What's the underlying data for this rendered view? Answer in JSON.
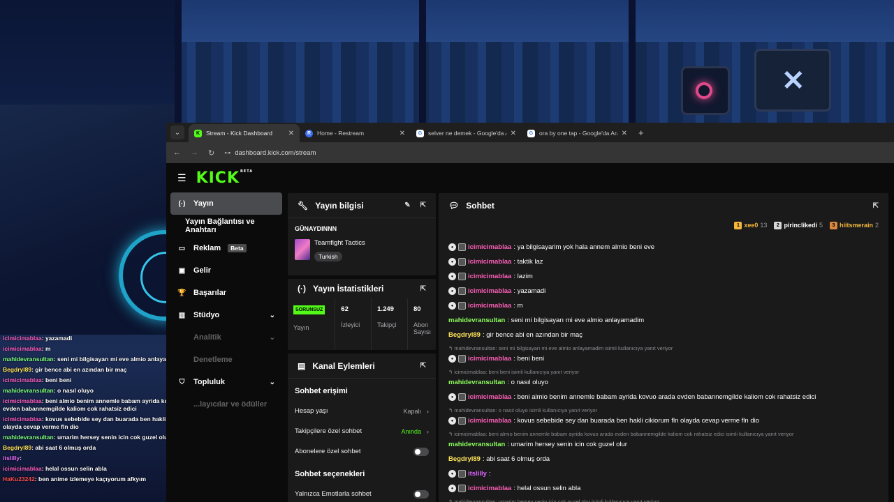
{
  "browser": {
    "tabs": [
      {
        "title": "Stream - Kick Dashboard",
        "favicon": "K",
        "color": "#53fc18",
        "active": true
      },
      {
        "title": "Home - Restream",
        "favicon": "R",
        "color": "#3c6df0",
        "active": false
      },
      {
        "title": "selver ne demek - Google'da Ara",
        "favicon": "G",
        "color": "#ffffff",
        "active": false
      },
      {
        "title": "ora by one tap - Google'da Ara",
        "favicon": "G",
        "color": "#ffffff",
        "active": false
      }
    ],
    "url": "dashboard.kick.com/stream"
  },
  "app": {
    "logo": "KICK",
    "logo_badge": "BETA"
  },
  "sidebar": {
    "items": [
      {
        "label": "Yayın",
        "icon": "(·)"
      },
      {
        "label": "Yayın Bağlantısı ve Anahtarı",
        "icon": ""
      },
      {
        "label": "Reklam",
        "icon": "▭",
        "badge": "Beta"
      },
      {
        "label": "Gelir",
        "icon": "▣"
      },
      {
        "label": "Başarılar",
        "icon": "🏆"
      },
      {
        "label": "Stüdyo",
        "icon": "▥"
      },
      {
        "label": "Analitik",
        "icon": ""
      },
      {
        "label": "Denetleme",
        "icon": ""
      },
      {
        "label": "Topluluk",
        "icon": "⛉"
      },
      {
        "label": "...layıcılar ve ödüller",
        "icon": ""
      }
    ]
  },
  "info": {
    "title": "Yayın bilgisi",
    "streamer": "GÜNAYDINNN",
    "game": "Teamfight Tactics",
    "language": "Turkish"
  },
  "stats": {
    "title": "Yayın İstatistikleri",
    "status": "SORUNSUZ",
    "items": [
      {
        "label": "Yayın",
        "value": ""
      },
      {
        "label": "İzleyici",
        "value": "62"
      },
      {
        "label": "Takipçi",
        "value": "1.249"
      },
      {
        "label": "Abon Sayısı",
        "value": "80"
      }
    ]
  },
  "actions": {
    "title": "Kanal Eylemleri",
    "section1": "Sohbet erişimi",
    "age": {
      "label": "Hesap yaşı",
      "value": "Kapalı"
    },
    "followers": {
      "label": "Takipçilere özel sohbet",
      "value": "Anında"
    },
    "subs": {
      "label": "Abonelere özel sohbet"
    },
    "section2": "Sohbet seçenekleri",
    "emotes": {
      "label": "Yalnızca Emotlarla sohbet"
    }
  },
  "chat": {
    "title": "Sohbet",
    "leaders": [
      {
        "rank": "1",
        "name": "xee0",
        "count": "13",
        "color": "#f4b73b",
        "name_color": "#f4b73b"
      },
      {
        "rank": "2",
        "name": "pirinclikedi",
        "count": "5",
        "color": "#d8d8d8",
        "name_color": "#ffffff"
      },
      {
        "rank": "3",
        "name": "hiitsmerain",
        "count": "2",
        "color": "#d9863e",
        "name_color": "#f4b73b"
      }
    ],
    "messages": [
      {
        "user": "icimicimablaa",
        "text": ": ya bilgisayarim yok hala annem almio beni eve",
        "color": "pink",
        "badges": true
      },
      {
        "user": "icimicimablaa",
        "text": ": taktik laz",
        "color": "pink",
        "badges": true
      },
      {
        "user": "icimicimablaa",
        "text": ": lazim",
        "color": "pink",
        "badges": true
      },
      {
        "user": "icimicimablaa",
        "text": ": yazamadi",
        "color": "pink",
        "badges": true
      },
      {
        "user": "icimicimablaa",
        "text": ": m",
        "color": "pink",
        "badges": true
      },
      {
        "user": "mahidevransultan",
        "text": ": seni mi bilgisayarı mi eve almio anlayamadim",
        "color": "green",
        "badges": false
      },
      {
        "user": "Begdryl89",
        "text": ": gir bence abi en azından bir maç",
        "color": "yel",
        "badges": false
      },
      {
        "reply": "mahidevransultan: seni mi bilgisayarı mi eve almio anlayamadim isimli kullanıcıya yanıt veriyor",
        "user": "icimicimablaa",
        "text": ": beni beni",
        "color": "pink",
        "badges": true
      },
      {
        "reply": "icimicimablaa: beni beni isimli kullanıcıya yanıt veriyor",
        "user": "mahidevransultan",
        "text": ": o nasıl oluyo",
        "color": "green",
        "badges": false
      },
      {
        "user": "icimicimablaa",
        "text": ": beni almio benim annemle babam ayrida kovuo arada evden babannemgilde kaliom cok rahatsiz edici",
        "color": "pink",
        "badges": true
      },
      {
        "reply": "mahidevransultan: o nasıl oluyo isimli kullanıcıya yanıt veriyor",
        "user": "icimicimablaa",
        "text": ": kovus sebebide sey dan buarada ben hakli cikiorum fln olayda cevap verme fln dio",
        "color": "pink",
        "badges": true
      },
      {
        "reply": "icimicimablaa: beni almio benim annemle babam ayrida kovuo arada evden babannemgilde kaliom cok rahatsiz edici isimli kullanıcıya yanıt veriyor",
        "user": "mahidevransultan",
        "text": ": umarim hersey senin icin cok guzel olur",
        "color": "green",
        "badges": false
      },
      {
        "user": "Begdryl89",
        "text": ": abi saat 6 olmuş orda",
        "color": "yel",
        "badges": false
      },
      {
        "user": "itslilly",
        "text": ":",
        "color": "purple",
        "badges": true
      },
      {
        "user": "icimicimablaa",
        "text": ": helal ossun selin abla",
        "color": "pink",
        "badges": true
      },
      {
        "reply": "mahidevransultan: umarim hersey senin icin cok guzel olur isimli kullanıcıya yanıt veriyor",
        "user": "",
        "text": "",
        "color": "pink",
        "badges": false
      }
    ]
  },
  "overlay": {
    "lines": [
      {
        "user": "icimicimablaa",
        "text": ": yazamadi",
        "c": ""
      },
      {
        "user": "icimicimablaa",
        "text": ": m",
        "c": ""
      },
      {
        "user": "mahidevransultan",
        "text": ": seni mi bilgisayarı mi eve almio anlayamadim",
        "c": "g"
      },
      {
        "user": "Begdryl89",
        "text": ": gir bence abi en azından bir maç",
        "c": "y"
      },
      {
        "user": "icimicimablaa",
        "text": ": beni beni",
        "c": ""
      },
      {
        "user": "mahidevransultan",
        "text": ": o nasıl oluyo",
        "c": "g"
      },
      {
        "user": "icimicimablaa",
        "text": ": beni almio benim annemle babam ayrida kovuo arada evden babannemgilde kaliom cok rahatsiz edici",
        "c": ""
      },
      {
        "user": "icimicimablaa",
        "text": ": kovus sebebide sey dan buarada ben hakli cikiorum fln olayda cevap verme fln dio",
        "c": ""
      },
      {
        "user": "mahidevransultan",
        "text": ": umarim hersey senin icin cok guzel olur",
        "c": "g"
      },
      {
        "user": "Begdryl89",
        "text": ": abi saat 6 olmuş orda",
        "c": "y"
      },
      {
        "user": "itslilly",
        "text": ":",
        "c": "p"
      },
      {
        "user": "icimicimablaa",
        "text": ": helal ossun selin abla",
        "c": ""
      },
      {
        "user": "HaKu23242",
        "text": ": ben anime izlemeye kaçıyorum afkyım",
        "c": "r"
      }
    ]
  }
}
